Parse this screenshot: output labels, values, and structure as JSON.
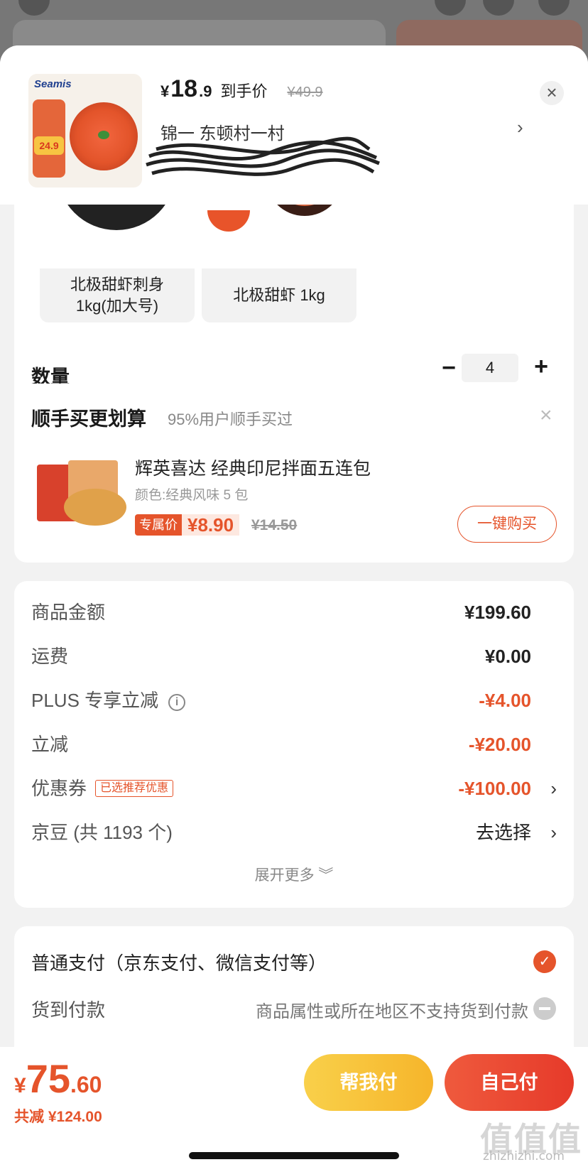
{
  "header": {
    "price_yen": "¥",
    "price_int": "18",
    "price_dec": ".9",
    "price_tag": "到手价",
    "original_price": "¥49.9",
    "address": "锦一 东顿村一村",
    "close_icon": "close-icon",
    "chevron_icon": "chevron-right-icon",
    "thumb_brand": "Seamis",
    "thumb_price": "24.9"
  },
  "variants": [
    {
      "label": "北极甜虾刺身\n1kg(加大号)"
    },
    {
      "label": "北极甜虾 1kg"
    }
  ],
  "quantity": {
    "label": "数量",
    "value": "4",
    "minus": "−",
    "plus": "+"
  },
  "upsell": {
    "title": "顺手买更划算",
    "subtitle": "95%用户顺手买过",
    "close": "×",
    "product_name": "辉英喜达 经典印尼拌面五连包",
    "product_spec": "颜色:经典风味 5 包",
    "tag": "专属价",
    "price": "¥8.90",
    "original_price": "¥14.50",
    "buy_label": "一键购买"
  },
  "breakdown": {
    "rows": [
      {
        "label": "商品金额",
        "value": "¥199.60"
      },
      {
        "label": "运费",
        "value": "¥0.00"
      },
      {
        "label": "PLUS 专享立减",
        "value": "-¥4.00"
      },
      {
        "label": "立减",
        "value": "-¥20.00"
      },
      {
        "label": "优惠券",
        "tag": "已选推荐优惠",
        "value": "-¥100.00"
      },
      {
        "label": "京豆 (共 1193 个)",
        "value": "去选择"
      }
    ],
    "expand_label": "展开更多 ︾"
  },
  "payment": {
    "option1": "普通支付（京东支付、微信支付等）",
    "option2": "货到付款",
    "option2_note": "商品属性或所在地区不支持货到付款"
  },
  "bottom": {
    "total_yen": "¥",
    "total_int": "75",
    "total_dec": ".60",
    "saved": "共减 ¥124.00",
    "help_pay": "帮我付",
    "self_pay": "自己付",
    "watermark": "值值值",
    "watermark_url": "zhizhizhi.com"
  },
  "colors": {
    "accent": "#e5542b",
    "help_button": "#f6b52b",
    "self_button": "#e63a2a"
  }
}
